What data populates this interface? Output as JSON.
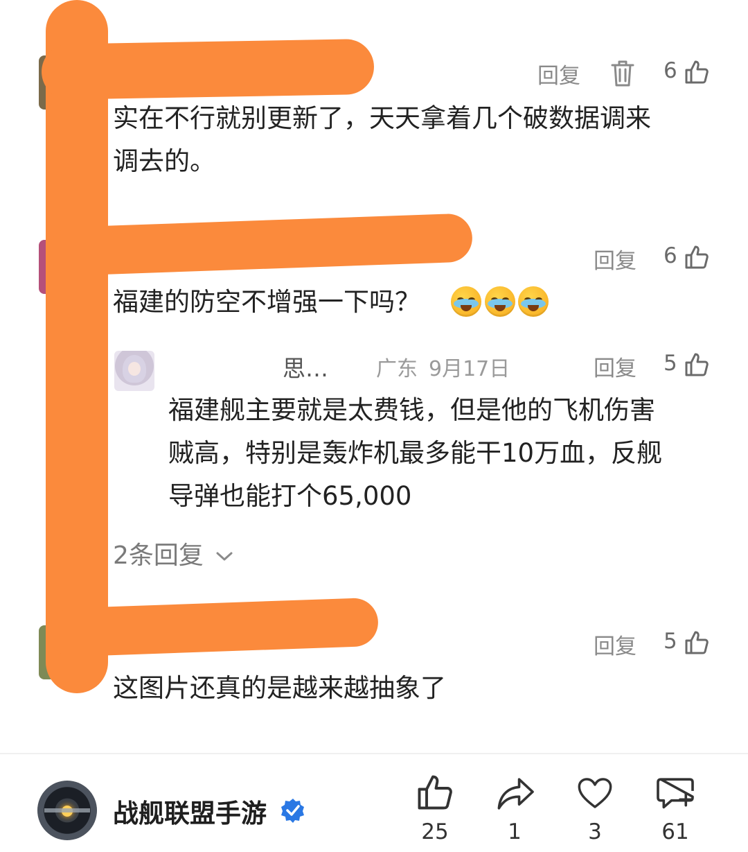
{
  "comments": [
    {
      "reply_label": "回复",
      "likes": "6",
      "text_line1": "实在不行就别更新了，天天拿着几个破数据调来",
      "text_line2": "调去的。"
    },
    {
      "reply_label": "回复",
      "likes": "6",
      "text": "福建的防空不增强一下吗？",
      "emojis": [
        "crying-laughing",
        "crying-laughing",
        "crying-laughing"
      ]
    },
    {
      "username": "思…",
      "location": "广东",
      "date": "9月17日",
      "reply_label": "回复",
      "likes": "5",
      "text_line1": "福建舰主要就是太费钱，但是他的飞机伤害",
      "text_line2": "贼高，特别是轰炸机最多能干10万血，反舰",
      "text_line3": "导弹也能打个65,000"
    },
    {
      "reply_label": "回复",
      "likes": "5",
      "text": "这图片还真的是越来越抽象了"
    }
  ],
  "more_replies": "2条回复",
  "footer": {
    "account_name": "战舰联盟手游",
    "likes": "25",
    "shares": "1",
    "favorites": "3",
    "comments": "61"
  },
  "colors": {
    "scribble": "#fb8a3c",
    "verified": "#2a78e4",
    "meta_gray": "#9a9a9a"
  }
}
